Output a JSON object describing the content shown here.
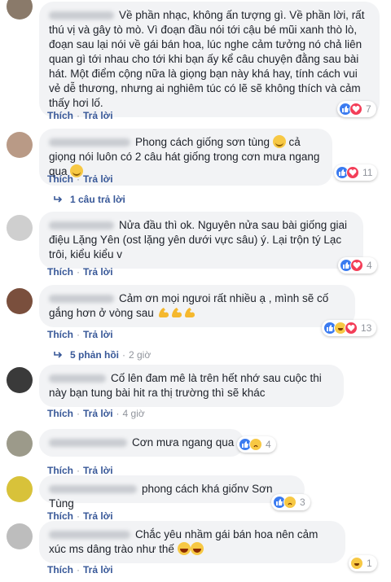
{
  "actions": {
    "like": "Thích",
    "reply": "Trả lời"
  },
  "colors": {
    "link": "#385898",
    "bubble": "#f2f3f5",
    "meta": "#90949c",
    "like": "#3b7bf0",
    "love": "#f33e58",
    "haha": "#f7c844"
  },
  "comments": [
    {
      "text": "Về phần nhạc, không ấn tượng gì. Về phần lời, rất thú vị và gây tò mò. Vì đoạn đầu nói tới cậu bé mũi xanh thò lò, đoạn sau lại nói về gái bán hoa, lúc nghe cảm tưởng nó chả liên quan gì tới nhau cho tới khi bạn ấy kể câu chuyện đằng sau bài hát. Một điểm cộng nữa là giọng bạn này khá hay, tính cách vui vẻ dễ thương, nhưng ai nghiêm túc có lẽ sẽ không thích và cảm thấy hơi lố.",
      "reaction_count": "7",
      "reaction_icons": [
        "like-icon",
        "love-icon"
      ]
    },
    {
      "text": "Phong cách giống sơn tùng",
      "text2": "cả giọng nói luôn có 2 câu hát giống trong cơn mưa ngang qua",
      "emojis": [
        "smile-emoji",
        "smile-emoji"
      ],
      "reaction_count": "11",
      "reaction_icons": [
        "like-icon",
        "love-icon"
      ],
      "replies_label": "1 câu trả lời"
    },
    {
      "text": "Nửa đầu thì ok. Nguyên nửa sau bài giống giai điệu Lặng Yên (ost lặng yên dưới vực sâu) ý. Lại trộn tý Lạc trôi, kiểu kiểu v",
      "reaction_count": "4",
      "reaction_icons": [
        "like-icon",
        "love-icon"
      ]
    },
    {
      "text": "Cảm ơn mọi ngưoi rất nhiều ạ , mình sẽ cố gắng hơn ở vòng sau",
      "emojis": [
        "muscle-emoji",
        "muscle-emoji",
        "muscle-emoji"
      ],
      "reaction_count": "13",
      "reaction_icons": [
        "like-icon",
        "haha-icon",
        "love-icon"
      ],
      "replies_label": "5 phản hồi",
      "replies_time": "2 giờ"
    },
    {
      "text": "Cố lên đam mê là trên hết nhớ sau cuộc thi này bạn tung bài hit ra thị trường thì sẽ khác",
      "time": "4 giờ"
    },
    {
      "text": "Cơn mưa ngang qua",
      "reaction_count": "4",
      "reaction_icons": [
        "like-icon",
        "sad-icon"
      ]
    },
    {
      "text": "phong cách khá giốnv Sơn Tùng",
      "reaction_count": "3",
      "reaction_icons": [
        "like-icon",
        "sad-icon"
      ]
    },
    {
      "text": "Chắc yêu nhầm gái bán hoa nên cảm xúc ms dâng trào như thế",
      "emojis": [
        "laugh-emoji",
        "laugh-emoji"
      ],
      "reaction_count": "1",
      "reaction_icons": [
        "haha-icon"
      ]
    }
  ]
}
